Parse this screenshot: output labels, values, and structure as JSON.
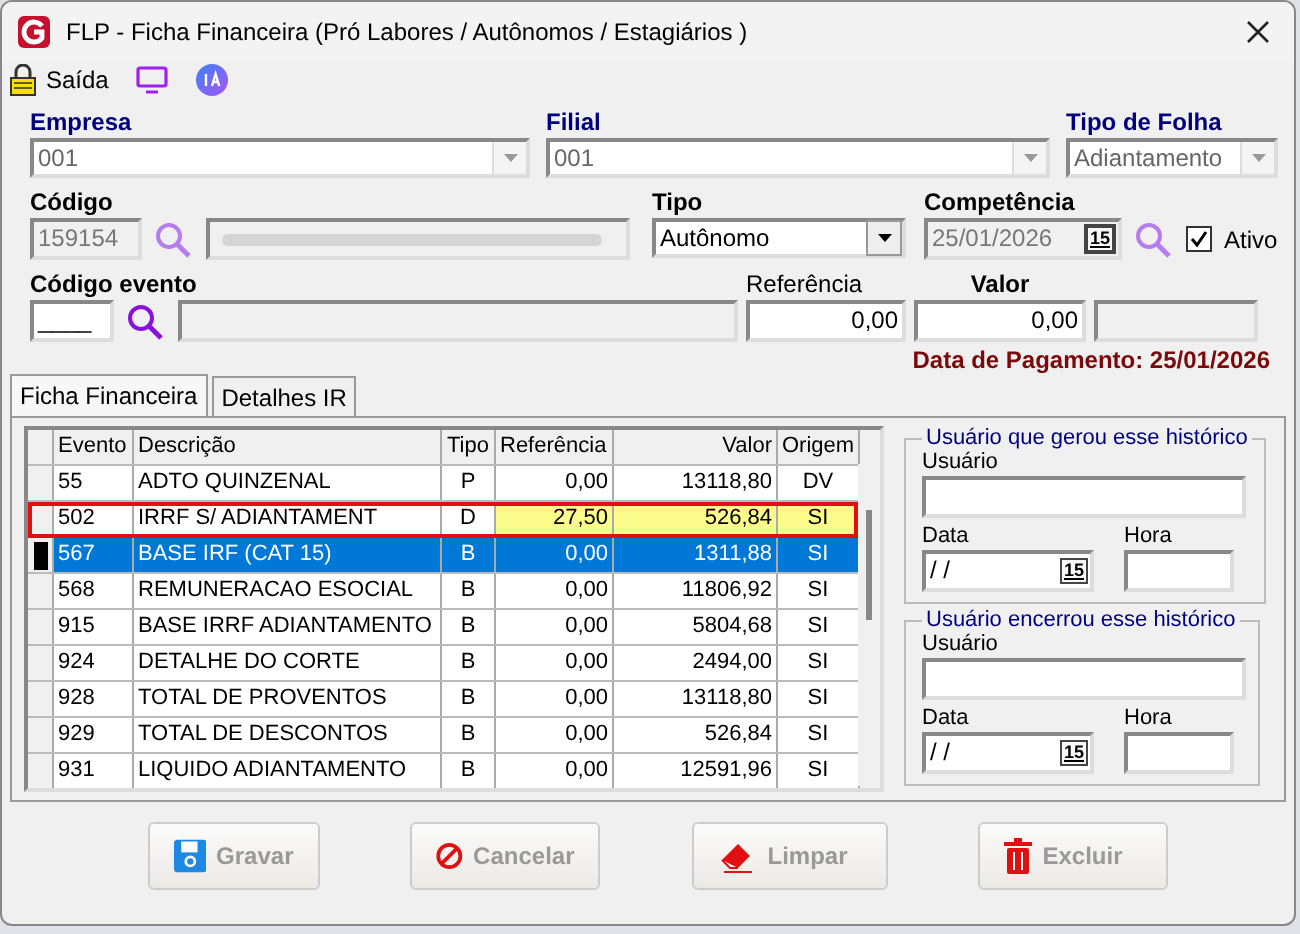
{
  "window": {
    "title": "FLP - Ficha Financeira (Pró Labores / Autônomos / Estagiários )"
  },
  "toolbar": {
    "exit_label": "Saída"
  },
  "empresa": {
    "label": "Empresa",
    "value": "001"
  },
  "filial": {
    "label": "Filial",
    "value": "001"
  },
  "tipo_folha": {
    "label": "Tipo de Folha",
    "value": "Adiantamento"
  },
  "codigo": {
    "label": "Código",
    "value": "159154"
  },
  "tipo": {
    "label": "Tipo",
    "value": "Autônomo"
  },
  "competencia": {
    "label": "Competência",
    "value": "25/01/2026",
    "calendar": "15"
  },
  "ativo": {
    "label": "Ativo",
    "checked": true
  },
  "codigo_evento": {
    "label": "Código evento",
    "value": "____"
  },
  "referencia": {
    "label": "Referência",
    "value": "0,00"
  },
  "valor": {
    "label": "Valor",
    "value": "0,00"
  },
  "data_pagamento": "Data de Pagamento: 25/01/2026",
  "tabs": [
    {
      "label": "Ficha Financeira",
      "selected": true
    },
    {
      "label": "Detalhes IR",
      "selected": false
    }
  ],
  "table": {
    "columns": [
      "Evento",
      "Descrição",
      "Tipo",
      "Referência",
      "Valor",
      "Origem"
    ],
    "rows": [
      {
        "cells": [
          "55",
          "ADTO QUINZENAL",
          "P",
          "0,00",
          "13118,80",
          "DV"
        ],
        "selected": false,
        "flagged": false
      },
      {
        "cells": [
          "502",
          "IRRF S/ ADIANTAMENT",
          "D",
          "27,50",
          "526,84",
          "SI"
        ],
        "selected": false,
        "flagged": true
      },
      {
        "cells": [
          "567",
          "BASE IRF (CAT 15)",
          "B",
          "0,00",
          "1311,88",
          "SI"
        ],
        "selected": true,
        "flagged": false
      },
      {
        "cells": [
          "568",
          "REMUNERACAO ESOCIAL",
          "B",
          "0,00",
          "11806,92",
          "SI"
        ],
        "selected": false,
        "flagged": false
      },
      {
        "cells": [
          "915",
          "BASE IRRF ADIANTAMENTO",
          "B",
          "0,00",
          "5804,68",
          "SI"
        ],
        "selected": false,
        "flagged": false
      },
      {
        "cells": [
          "924",
          "DETALHE DO CORTE",
          "B",
          "0,00",
          "2494,00",
          "SI"
        ],
        "selected": false,
        "flagged": false
      },
      {
        "cells": [
          "928",
          "TOTAL DE PROVENTOS",
          "B",
          "0,00",
          "13118,80",
          "SI"
        ],
        "selected": false,
        "flagged": false
      },
      {
        "cells": [
          "929",
          "TOTAL DE DESCONTOS",
          "B",
          "0,00",
          "526,84",
          "SI"
        ],
        "selected": false,
        "flagged": false
      },
      {
        "cells": [
          "931",
          "LIQUIDO ADIANTAMENTO",
          "B",
          "0,00",
          "12591,96",
          "SI"
        ],
        "selected": false,
        "flagged": false
      }
    ]
  },
  "groups": [
    {
      "title": "Usuário que gerou esse histórico",
      "user_label": "Usuário",
      "date_label": "Data",
      "date_value": " /  /",
      "calendar": "15",
      "time_label": "Hora"
    },
    {
      "title": "Usuário encerrou esse histórico",
      "user_label": "Usuário",
      "date_label": "Data",
      "date_value": " /  /",
      "calendar": "15",
      "time_label": "Hora"
    }
  ],
  "buttons": [
    {
      "kind": "save",
      "label": "Gravar",
      "disabled": true
    },
    {
      "kind": "cancel",
      "label": "Cancelar",
      "disabled": true
    },
    {
      "kind": "clear",
      "label": "Limpar",
      "disabled": true
    },
    {
      "kind": "delete",
      "label": "Excluir",
      "disabled": true
    }
  ]
}
